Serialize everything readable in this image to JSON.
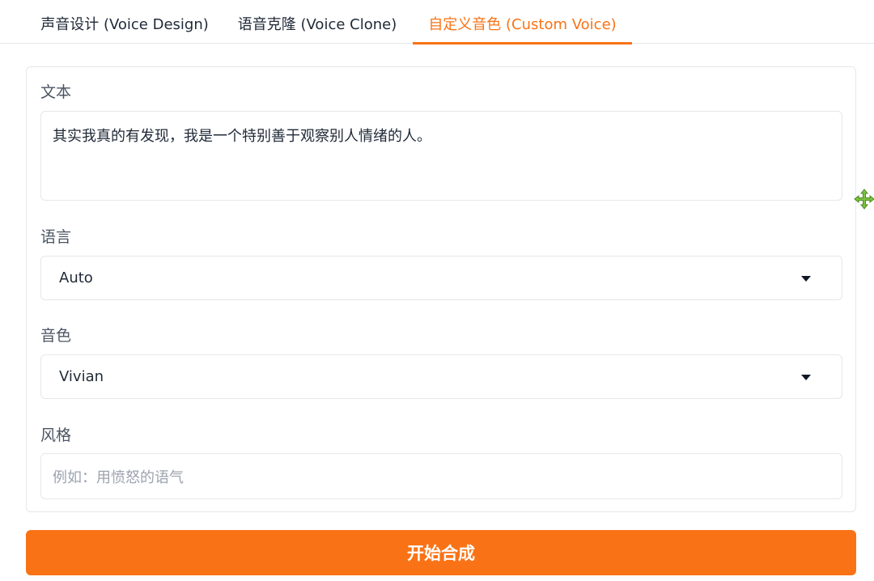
{
  "tabs": [
    {
      "label": "声音设计 (Voice Design)",
      "active": false
    },
    {
      "label": "语音克隆 (Voice Clone)",
      "active": false
    },
    {
      "label": "自定义音色 (Custom Voice)",
      "active": true
    }
  ],
  "form": {
    "text": {
      "label": "文本",
      "value": "其实我真的有发现，我是一个特别善于观察别人情绪的人。"
    },
    "language": {
      "label": "语言",
      "value": "Auto"
    },
    "speaker": {
      "label": "音色",
      "value": "Vivian"
    },
    "style": {
      "label": "风格",
      "placeholder": "例如：用愤怒的语气",
      "value": ""
    }
  },
  "submit": {
    "label": "开始合成"
  },
  "colors": {
    "accent": "#f97316",
    "border": "#e5e7eb",
    "text": "#1f2937",
    "label": "#4b5563",
    "placeholder": "#9ca3af",
    "move_cursor": "#7cc242"
  },
  "icons": {
    "dropdown": "caret-down-icon",
    "cursor": "move-cursor-icon"
  }
}
